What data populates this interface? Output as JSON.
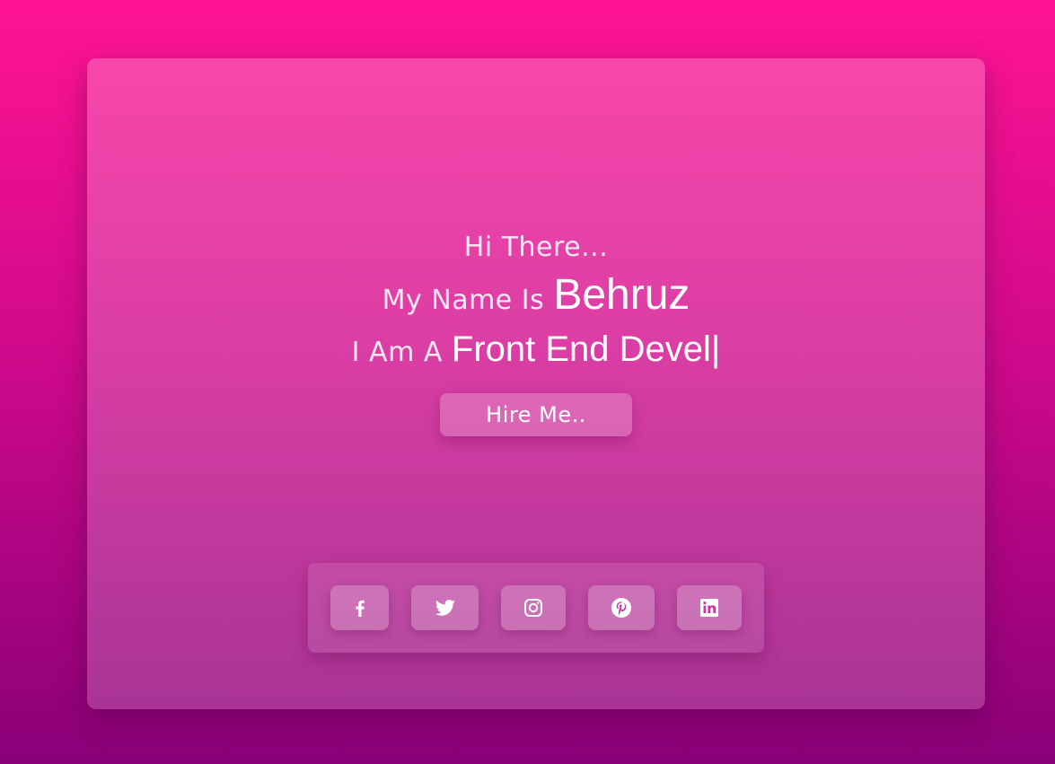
{
  "hero": {
    "greeting": "Hi There...",
    "name_prefix": "My Name Is",
    "name": "Behruz",
    "role_prefix": "I Am A",
    "role_typed": "Front End Devel|",
    "hire_label": "Hire Me.."
  },
  "social": {
    "icons": [
      "facebook-icon",
      "twitter-icon",
      "instagram-icon",
      "pinterest-icon",
      "linkedin-icon"
    ]
  },
  "colors": {
    "background_top": "#ff1493",
    "background_bottom": "#8a0078",
    "text": "#ffffff"
  }
}
